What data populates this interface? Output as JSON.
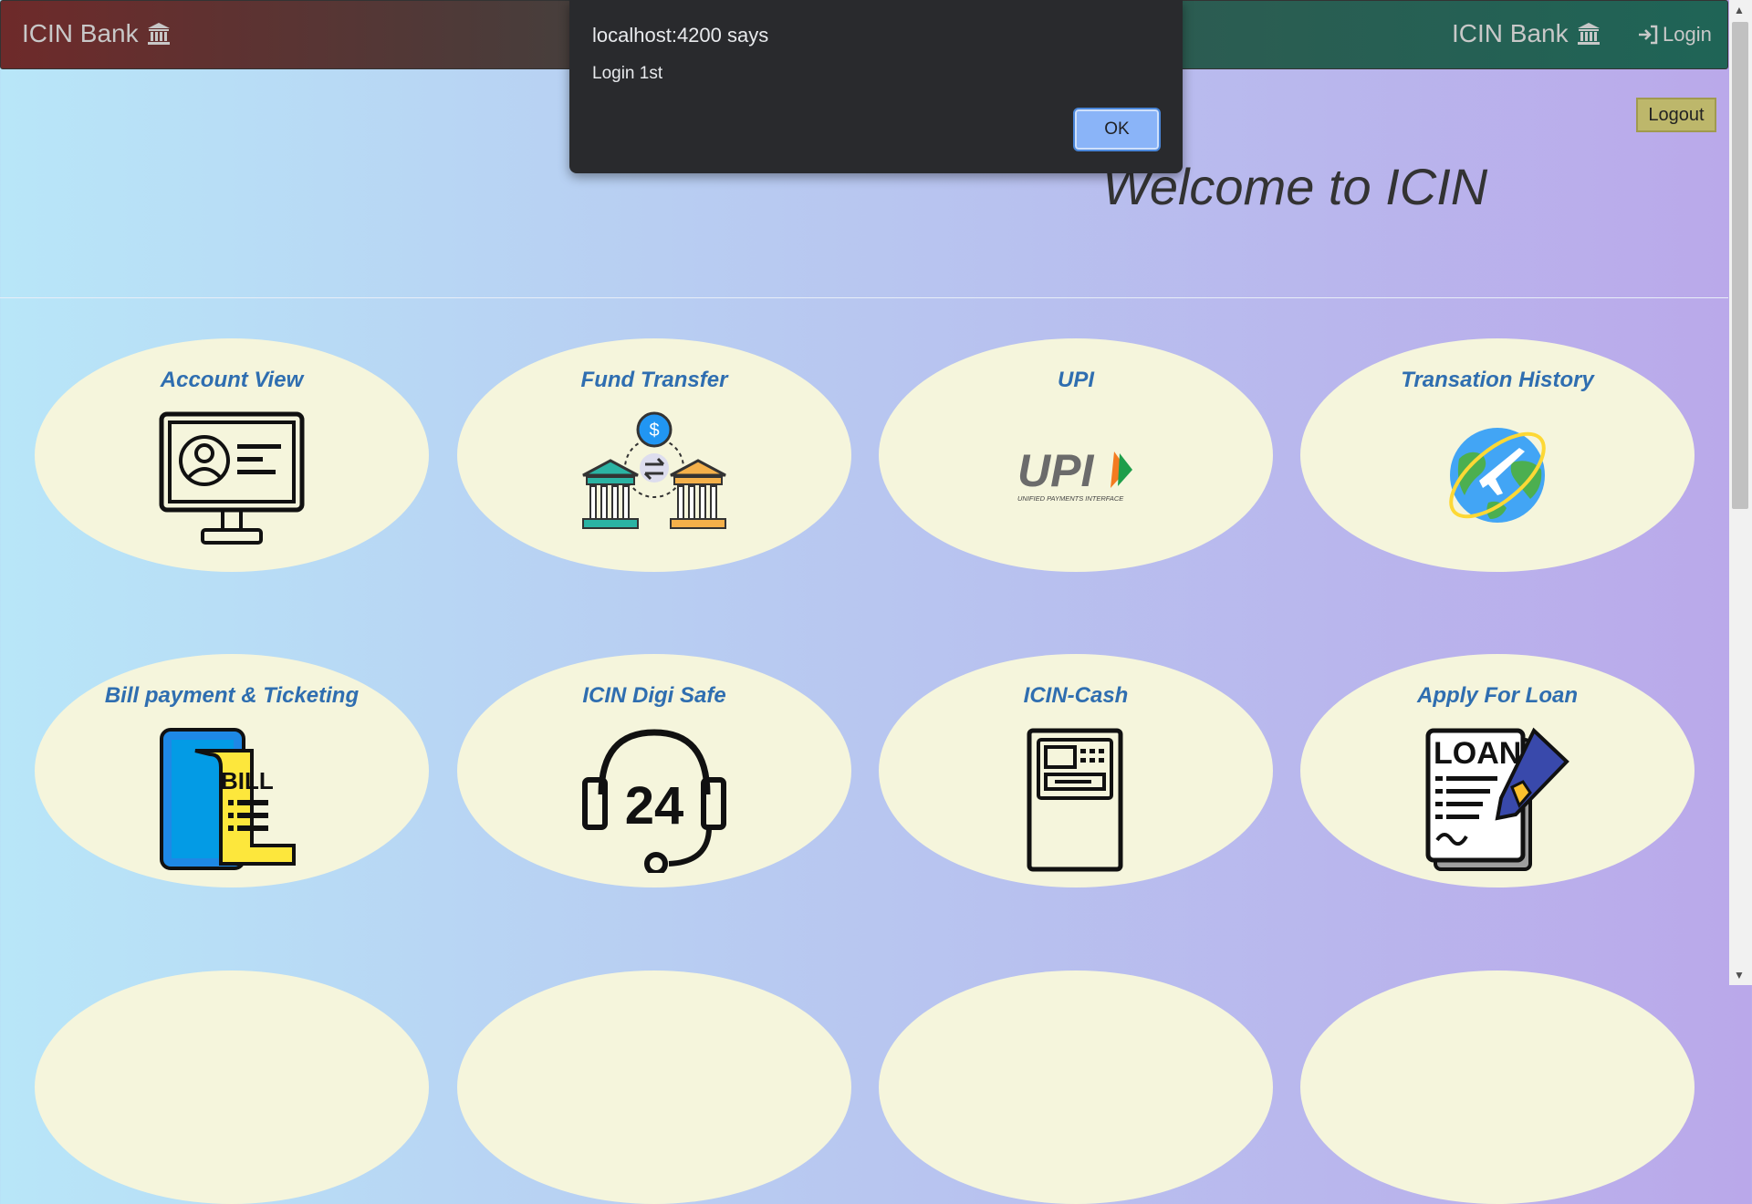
{
  "navbar": {
    "brand_left": "ICIN Bank",
    "brand_right": "ICIN Bank",
    "login_label": "Login"
  },
  "logout_label": "Logout",
  "welcome": "Welcome to ICIN",
  "cards": [
    {
      "title": "Account View",
      "icon": "account-view-icon"
    },
    {
      "title": "Fund Transfer",
      "icon": "fund-transfer-icon"
    },
    {
      "title": "UPI",
      "icon": "upi-logo-icon"
    },
    {
      "title": "Transation History",
      "icon": "globe-plane-icon"
    },
    {
      "title": "Bill payment & Ticketing",
      "icon": "bill-phone-icon"
    },
    {
      "title": "ICIN Digi Safe",
      "icon": "headset-24-icon"
    },
    {
      "title": "ICIN-Cash",
      "icon": "atm-icon"
    },
    {
      "title": "Apply For Loan",
      "icon": "loan-document-icon"
    }
  ],
  "upi_logo_text": "UPI",
  "upi_sub_text": "UNIFIED PAYMENTS INTERFACE",
  "bill_text": "BILL",
  "loan_text": "LOAN",
  "digi_text": "24",
  "dialog": {
    "title": "localhost:4200 says",
    "message": "Login 1st",
    "ok_label": "OK"
  },
  "colors": {
    "card_bg": "#f5f5dc",
    "card_title": "#2f6eb0",
    "dialog_bg": "#292a2d",
    "ok_button": "#8ab4f8",
    "logout_bg": "#bdb76b"
  }
}
